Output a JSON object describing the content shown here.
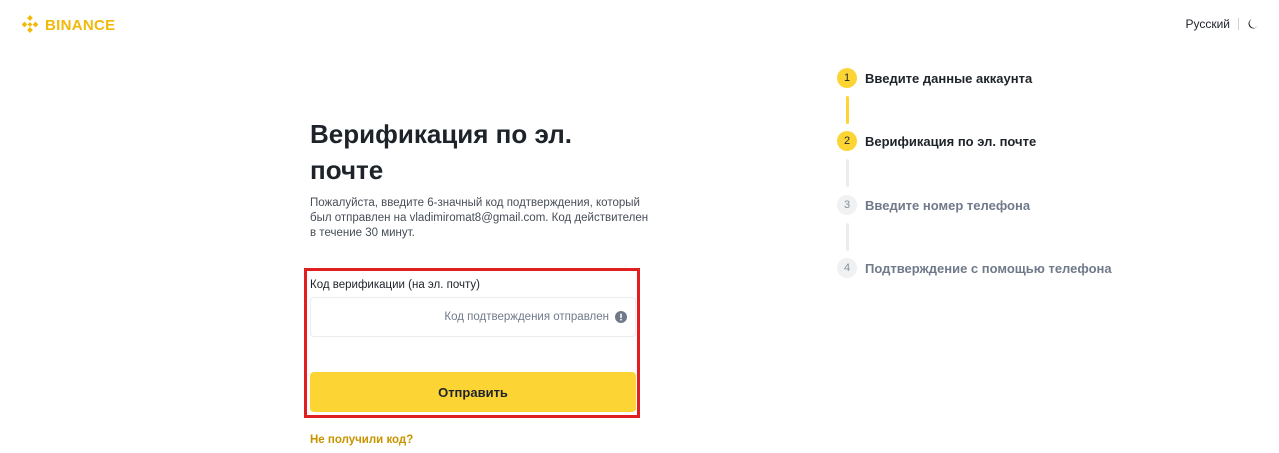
{
  "header": {
    "brand": "BINANCE",
    "language": "Русский",
    "brand_color": "#F0B90B"
  },
  "form": {
    "title": "Верификация по эл. почте",
    "description": "Пожалуйста, введите 6-значный код подтверждения, который был отправлен на vladimiromat8@gmail.com. Код действителен в течение 30 минут.",
    "field_label": "Код верификации (на эл. почту)",
    "field_value": "",
    "field_status": "Код подтверждения отправлен",
    "submit_label": "Отправить",
    "resend_label": "Не получили код?"
  },
  "steps": [
    {
      "number": "1",
      "label": "Введите данные аккаунта",
      "state": "completed"
    },
    {
      "number": "2",
      "label": "Верификация по эл. почте",
      "state": "current"
    },
    {
      "number": "3",
      "label": "Введите номер телефона",
      "state": "pending"
    },
    {
      "number": "4",
      "label": "Подтверждение с помощью телефона",
      "state": "pending"
    }
  ],
  "colors": {
    "accent": "#FCD535",
    "highlight_border": "#e02020",
    "link": "#C99400"
  }
}
